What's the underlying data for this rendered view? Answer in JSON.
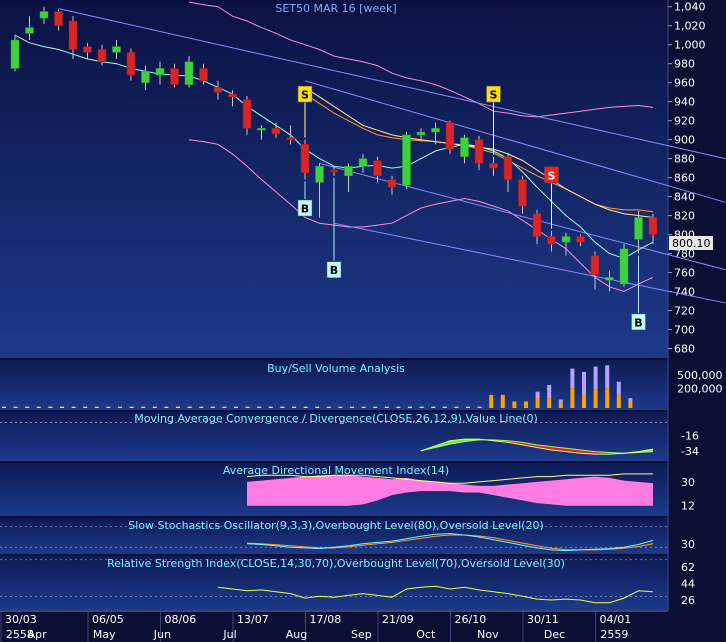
{
  "title": "SET50 MAR 16   [week]",
  "last_price_label": "800.10",
  "colors": {
    "bg_top": "#0b1142",
    "bg_bottom": "#1c3a8a",
    "up": "#3ed13e",
    "down": "#d7262a",
    "text": "#ffffff",
    "title": "#7fb0ff",
    "panel_title": "#7ff0ff",
    "trend": "#8a8cff",
    "ma_short": "#9fffe0",
    "ma_mid": "#ffe98a",
    "ma_long": "#ff9a2e",
    "band": "#ff8ad8",
    "buy": "#bfffff",
    "sell_yellow": "#ffe000",
    "sell_red": "#ff1a1a",
    "adx_fill": "#ff7de3",
    "macd_green": "#7cff4a",
    "macd_red": "#ff1a1a"
  },
  "chart_data": [
    {
      "name": "price",
      "type": "candlestick",
      "ylim": [
        670,
        1045
      ],
      "yticks": [
        680,
        700,
        720,
        740,
        760,
        780,
        800,
        820,
        840,
        860,
        880,
        900,
        920,
        940,
        960,
        980,
        1000,
        1020,
        1040
      ],
      "candles": [
        {
          "o": 975,
          "h": 1010,
          "l": 972,
          "c": 1005
        },
        {
          "o": 1012,
          "h": 1030,
          "l": 1005,
          "c": 1018
        },
        {
          "o": 1028,
          "h": 1040,
          "l": 1022,
          "c": 1035
        },
        {
          "o": 1035,
          "h": 1037,
          "l": 1015,
          "c": 1020
        },
        {
          "o": 1025,
          "h": 1030,
          "l": 985,
          "c": 995
        },
        {
          "o": 998,
          "h": 1002,
          "l": 985,
          "c": 992
        },
        {
          "o": 995,
          "h": 1000,
          "l": 978,
          "c": 982
        },
        {
          "o": 992,
          "h": 1005,
          "l": 985,
          "c": 998
        },
        {
          "o": 992,
          "h": 996,
          "l": 962,
          "c": 968
        },
        {
          "o": 960,
          "h": 978,
          "l": 952,
          "c": 972
        },
        {
          "o": 968,
          "h": 982,
          "l": 958,
          "c": 975
        },
        {
          "o": 975,
          "h": 980,
          "l": 955,
          "c": 958
        },
        {
          "o": 958,
          "h": 988,
          "l": 955,
          "c": 982
        },
        {
          "o": 975,
          "h": 980,
          "l": 958,
          "c": 962
        },
        {
          "o": 955,
          "h": 962,
          "l": 942,
          "c": 950
        },
        {
          "o": 948,
          "h": 952,
          "l": 935,
          "c": 945
        },
        {
          "o": 942,
          "h": 946,
          "l": 905,
          "c": 912
        },
        {
          "o": 910,
          "h": 915,
          "l": 900,
          "c": 912
        },
        {
          "o": 912,
          "h": 918,
          "l": 902,
          "c": 906
        },
        {
          "o": 902,
          "h": 915,
          "l": 895,
          "c": 900
        },
        {
          "o": 895,
          "h": 900,
          "l": 858,
          "c": 865
        },
        {
          "o": 855,
          "h": 875,
          "l": 818,
          "c": 872
        },
        {
          "o": 868,
          "h": 872,
          "l": 862,
          "c": 866
        },
        {
          "o": 862,
          "h": 875,
          "l": 845,
          "c": 872
        },
        {
          "o": 872,
          "h": 885,
          "l": 865,
          "c": 880
        },
        {
          "o": 878,
          "h": 882,
          "l": 855,
          "c": 862
        },
        {
          "o": 858,
          "h": 862,
          "l": 842,
          "c": 850
        },
        {
          "o": 852,
          "h": 908,
          "l": 848,
          "c": 905
        },
        {
          "o": 905,
          "h": 912,
          "l": 898,
          "c": 908
        },
        {
          "o": 908,
          "h": 918,
          "l": 895,
          "c": 912
        },
        {
          "o": 918,
          "h": 920,
          "l": 885,
          "c": 890
        },
        {
          "o": 882,
          "h": 905,
          "l": 875,
          "c": 902
        },
        {
          "o": 900,
          "h": 904,
          "l": 868,
          "c": 875
        },
        {
          "o": 875,
          "h": 882,
          "l": 862,
          "c": 870
        },
        {
          "o": 882,
          "h": 886,
          "l": 845,
          "c": 858
        },
        {
          "o": 858,
          "h": 862,
          "l": 822,
          "c": 830
        },
        {
          "o": 822,
          "h": 826,
          "l": 790,
          "c": 798
        },
        {
          "o": 798,
          "h": 804,
          "l": 782,
          "c": 790
        },
        {
          "o": 792,
          "h": 802,
          "l": 778,
          "c": 798
        },
        {
          "o": 798,
          "h": 800,
          "l": 788,
          "c": 792
        },
        {
          "o": 778,
          "h": 782,
          "l": 742,
          "c": 758
        },
        {
          "o": 752,
          "h": 762,
          "l": 740,
          "c": 755
        },
        {
          "o": 748,
          "h": 790,
          "l": 745,
          "c": 785
        },
        {
          "o": 795,
          "h": 825,
          "l": 780,
          "c": 818
        },
        {
          "o": 818,
          "h": 822,
          "l": 790,
          "c": 800
        }
      ],
      "ma_short": [
        1010,
        1002,
        998,
        995,
        990,
        985,
        982,
        980,
        975,
        972,
        969,
        968,
        967,
        962,
        955,
        948,
        935,
        925,
        915,
        905,
        890,
        880,
        872,
        870,
        872,
        873,
        870,
        872,
        880,
        888,
        892,
        895,
        893,
        888,
        880,
        866,
        850,
        835,
        820,
        808,
        792,
        780,
        775,
        784,
        792
      ],
      "ma_mid": [
        null,
        null,
        null,
        null,
        null,
        null,
        null,
        null,
        null,
        null,
        null,
        null,
        null,
        null,
        null,
        null,
        null,
        null,
        null,
        null,
        955,
        945,
        935,
        925,
        915,
        910,
        905,
        902,
        900,
        898,
        896,
        894,
        892,
        890,
        885,
        878,
        868,
        858,
        848,
        840,
        832,
        826,
        822,
        820,
        818
      ],
      "ma_long": [
        null,
        null,
        null,
        null,
        null,
        null,
        null,
        null,
        null,
        null,
        null,
        null,
        null,
        null,
        null,
        null,
        null,
        null,
        null,
        null,
        948,
        938,
        928,
        920,
        912,
        905,
        902,
        900,
        899,
        898,
        896,
        894,
        890,
        886,
        878,
        870,
        862,
        855,
        848,
        840,
        832,
        828,
        826,
        826,
        824
      ],
      "band_upper": [
        null,
        null,
        null,
        null,
        null,
        null,
        null,
        null,
        null,
        null,
        null,
        null,
        1045,
        1042,
        1040,
        1030,
        1025,
        1018,
        1012,
        1005,
        1000,
        995,
        988,
        985,
        982,
        978,
        970,
        965,
        962,
        958,
        952,
        945,
        938,
        930,
        928,
        925,
        924,
        926,
        928,
        930,
        932,
        934,
        935,
        936,
        934
      ],
      "band_lower": [
        null,
        null,
        null,
        null,
        null,
        null,
        null,
        null,
        null,
        null,
        null,
        null,
        900,
        898,
        895,
        885,
        872,
        858,
        845,
        832,
        818,
        812,
        810,
        808,
        808,
        810,
        812,
        820,
        828,
        832,
        835,
        838,
        835,
        830,
        825,
        815,
        805,
        795,
        785,
        770,
        755,
        745,
        740,
        748,
        755
      ],
      "trend_upper": {
        "from": [
          3,
          1038
        ],
        "to": [
          49,
          880
        ]
      },
      "trend_mid": {
        "from": [
          20,
          962
        ],
        "to": [
          49,
          834
        ]
      },
      "trend_low1": {
        "from": [
          21,
          875
        ],
        "to": [
          49,
          763
        ]
      },
      "trend_low2": {
        "from": [
          22,
          812
        ],
        "to": [
          49,
          728
        ]
      },
      "signals": [
        {
          "i": 20,
          "text": "S",
          "kind": "sell_yellow",
          "v": 948
        },
        {
          "i": 20,
          "text": "B",
          "kind": "buy",
          "v": 828
        },
        {
          "i": 22,
          "text": "B",
          "kind": "buy",
          "v": 763
        },
        {
          "i": 33,
          "text": "S",
          "kind": "sell_yellow",
          "v": 948
        },
        {
          "i": 37,
          "text": "S",
          "kind": "sell_red",
          "v": 863
        },
        {
          "i": 43,
          "text": "B",
          "kind": "buy",
          "v": 708
        }
      ]
    },
    {
      "name": "volume",
      "title": "Buy/Sell Volume Analysis",
      "type": "bar",
      "ylim": [
        0,
        700000
      ],
      "ytick_labels": [
        "500,000",
        "200,000"
      ],
      "ytick_values": [
        500000,
        300000
      ],
      "buy": [
        20000,
        20000,
        20000,
        20000,
        20000,
        20000,
        20000,
        20000,
        20000,
        20000,
        20000,
        20000,
        20000,
        20000,
        20000,
        20000,
        20000,
        20000,
        20000,
        20000,
        20000,
        20000,
        20000,
        20000,
        20000,
        20000,
        20000,
        20000,
        20000,
        20000,
        20000,
        20000,
        20000,
        20000,
        20000,
        20000,
        20000,
        20000,
        20000,
        20000,
        20000,
        20000,
        200000,
        200000,
        100000,
        100000,
        150000,
        150000,
        80000,
        300000,
        200000,
        280000,
        300000,
        200000,
        100000
      ],
      "sell": [
        0,
        0,
        0,
        0,
        0,
        0,
        0,
        0,
        0,
        0,
        0,
        0,
        0,
        0,
        0,
        0,
        0,
        0,
        0,
        0,
        0,
        0,
        0,
        0,
        0,
        0,
        0,
        0,
        0,
        0,
        0,
        0,
        0,
        0,
        0,
        0,
        0,
        0,
        0,
        0,
        0,
        0,
        0,
        0,
        0,
        0,
        100000,
        200000,
        50000,
        300000,
        350000,
        350000,
        350000,
        200000,
        50000
      ]
    },
    {
      "name": "macd",
      "title": "Moving Average Convergence / Divergence(CLOSE,26,12,9),Value Line(0)",
      "type": "line",
      "ylim": [
        -45,
        10
      ],
      "ytick_labels": [
        "-16",
        "-34"
      ],
      "ytick_values": [
        -16,
        -34
      ],
      "macd": [
        null,
        null,
        null,
        null,
        null,
        null,
        null,
        null,
        null,
        null,
        null,
        null,
        null,
        null,
        null,
        null,
        null,
        null,
        null,
        null,
        null,
        null,
        null,
        null,
        null,
        null,
        null,
        null,
        -34,
        -28,
        -22,
        -20,
        -20,
        -22,
        -24,
        -27,
        -30,
        -33,
        -35,
        -37,
        -38,
        -38,
        -37,
        -35,
        -32
      ],
      "signal": [
        null,
        null,
        null,
        null,
        null,
        null,
        null,
        null,
        null,
        null,
        null,
        null,
        null,
        null,
        null,
        null,
        null,
        null,
        null,
        null,
        null,
        null,
        null,
        null,
        null,
        null,
        null,
        null,
        -34,
        -30,
        -26,
        -23,
        -21,
        -21,
        -22,
        -24,
        -27,
        -29,
        -31,
        -33,
        -35,
        -36,
        -37,
        -36,
        -35
      ]
    },
    {
      "name": "adx",
      "title": "Average Directional Movement Index(14)",
      "type": "area",
      "ylim": [
        5,
        42
      ],
      "ytick_labels": [
        "30",
        "12"
      ],
      "ytick_values": [
        30,
        12
      ],
      "upper": [
        null,
        null,
        null,
        null,
        null,
        null,
        null,
        null,
        null,
        null,
        null,
        null,
        null,
        null,
        null,
        null,
        30,
        31,
        32,
        33,
        34,
        35,
        35,
        35,
        34,
        33,
        32,
        33,
        31,
        30,
        29,
        28,
        27,
        27,
        28,
        29,
        30,
        31,
        32,
        33,
        34,
        33,
        31,
        30,
        29
      ],
      "lower": [
        null,
        null,
        null,
        null,
        null,
        null,
        null,
        null,
        null,
        null,
        null,
        null,
        null,
        null,
        null,
        null,
        12,
        12,
        12,
        12,
        12,
        12,
        12,
        12,
        13,
        16,
        20,
        22,
        23,
        23,
        23,
        22,
        22,
        20,
        18,
        16,
        14,
        13,
        12,
        12,
        12,
        12,
        12,
        12,
        12
      ],
      "line": [
        null,
        null,
        null,
        null,
        null,
        null,
        null,
        null,
        null,
        null,
        null,
        null,
        null,
        null,
        null,
        null,
        34,
        35,
        35,
        35,
        34,
        34,
        35,
        35,
        35,
        34,
        33,
        32,
        31,
        30,
        29,
        29,
        30,
        31,
        32,
        33,
        34,
        34,
        35,
        35,
        35,
        35,
        36,
        36,
        36
      ]
    },
    {
      "name": "stoch",
      "title": "Slow Stochastics Oscillator(9,3,3),Overbought Level(80),Oversold Level(20)",
      "type": "line",
      "ylim": [
        0,
        100
      ],
      "ytick_labels": [
        "30"
      ],
      "ytick_values": [
        30
      ],
      "levels": [
        80,
        20
      ],
      "k": [
        null,
        null,
        null,
        null,
        null,
        null,
        null,
        null,
        null,
        null,
        null,
        null,
        null,
        null,
        null,
        null,
        30,
        28,
        24,
        20,
        18,
        16,
        20,
        24,
        30,
        34,
        38,
        45,
        52,
        58,
        60,
        56,
        50,
        42,
        34,
        26,
        18,
        12,
        10,
        12,
        14,
        16,
        20,
        28,
        40
      ],
      "d": [
        null,
        null,
        null,
        null,
        null,
        null,
        null,
        null,
        null,
        null,
        null,
        null,
        null,
        null,
        null,
        null,
        32,
        30,
        27,
        24,
        21,
        18,
        18,
        21,
        26,
        30,
        34,
        40,
        46,
        52,
        56,
        56,
        53,
        48,
        40,
        32,
        24,
        17,
        13,
        12,
        12,
        14,
        17,
        22,
        30
      ]
    },
    {
      "name": "rsi",
      "title": "Relative Strength Index(CLOSE,14,30,70),Overbought Level(70),Oversold Level(30)",
      "type": "line",
      "ylim": [
        15,
        72
      ],
      "ytick_labels": [
        "62",
        "44",
        "26"
      ],
      "ytick_values": [
        62,
        44,
        26
      ],
      "rsi": [
        null,
        null,
        null,
        null,
        null,
        null,
        null,
        null,
        null,
        null,
        null,
        null,
        null,
        null,
        40,
        38,
        36,
        37,
        35,
        33,
        28,
        30,
        29,
        31,
        33,
        31,
        29,
        38,
        40,
        41,
        38,
        40,
        37,
        35,
        33,
        30,
        27,
        26,
        27,
        26,
        23,
        23,
        28,
        36,
        35
      ]
    }
  ],
  "x_axis": {
    "date_labels": [
      "30/03",
      "06/05",
      "08/06",
      "13/07",
      "17/08",
      "21/09",
      "26/10",
      "30/11",
      "04/01"
    ],
    "date_index": [
      0,
      6,
      11,
      16,
      21,
      26,
      31,
      36,
      41
    ],
    "month_labels": [
      "2558",
      "Apr",
      "May",
      "Jun",
      "Jul",
      "Aug",
      "Sep",
      "Oct",
      "Nov",
      "Dec",
      "2559"
    ],
    "month_index": [
      0.2,
      1.7,
      6.2,
      10.4,
      15.2,
      19.5,
      24,
      28.5,
      32.7,
      37.3,
      41.2
    ]
  }
}
